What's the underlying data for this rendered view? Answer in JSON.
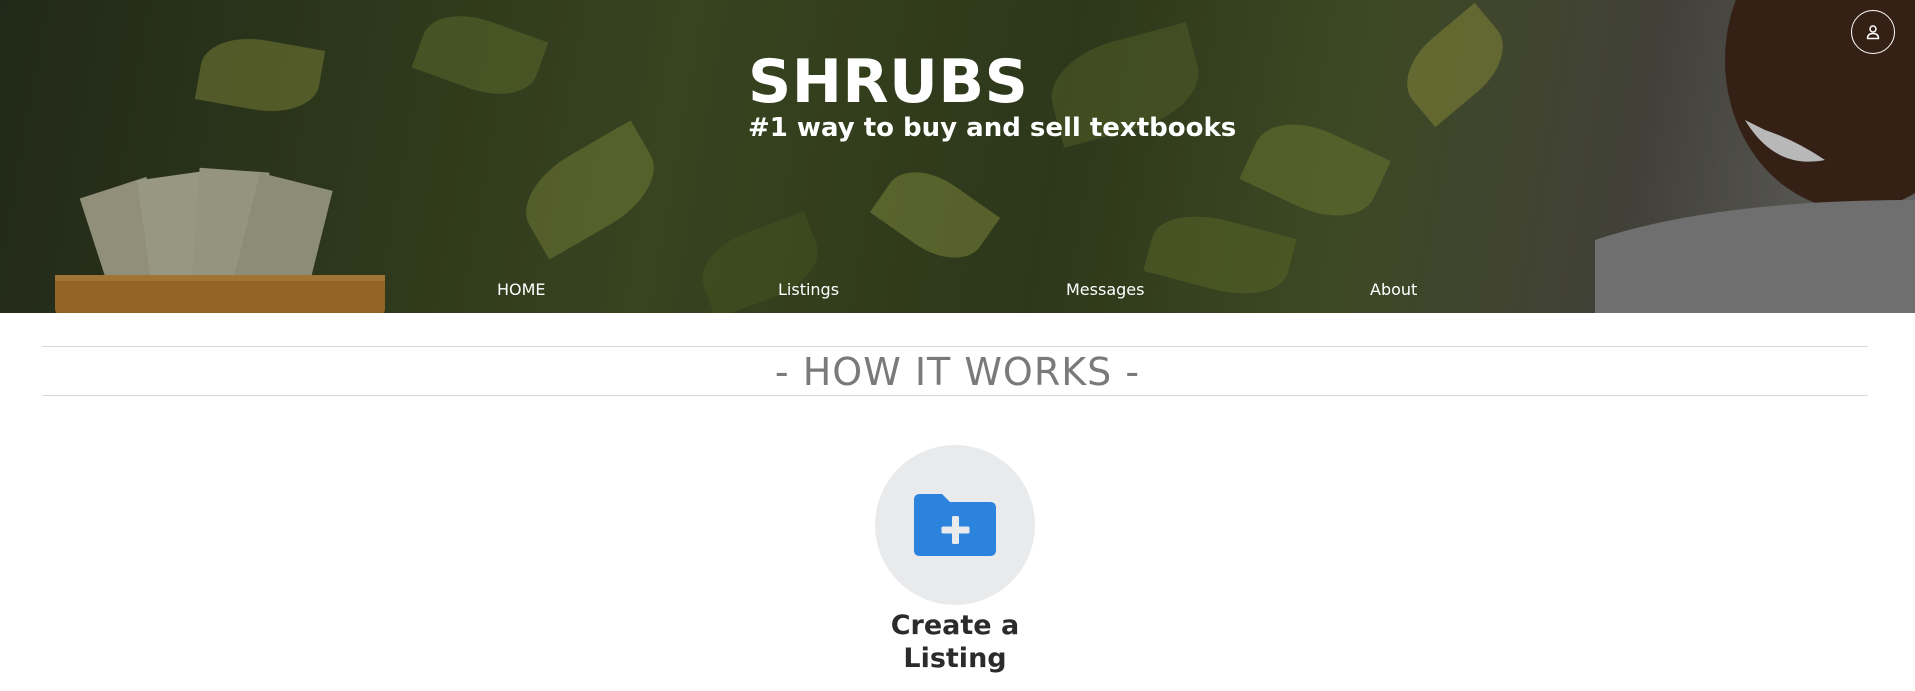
{
  "brand": {
    "title": "SHRUBS",
    "tagline": "#1 way to buy and sell textbooks"
  },
  "header": {
    "profile_icon": "user-icon"
  },
  "nav": {
    "items": [
      {
        "label": "HOME"
      },
      {
        "label": "Listings"
      },
      {
        "label": "Messages"
      },
      {
        "label": "About"
      }
    ]
  },
  "how_it_works": {
    "title": "- HOW IT WORKS -",
    "steps": [
      {
        "label": "Create a Listing",
        "icon": "folder-plus-icon",
        "icon_color": "#2b83dd"
      }
    ]
  },
  "colors": {
    "hero_overlay": "#000000",
    "step_circle": "#e9eaec",
    "section_title": "#7a7a7a"
  }
}
